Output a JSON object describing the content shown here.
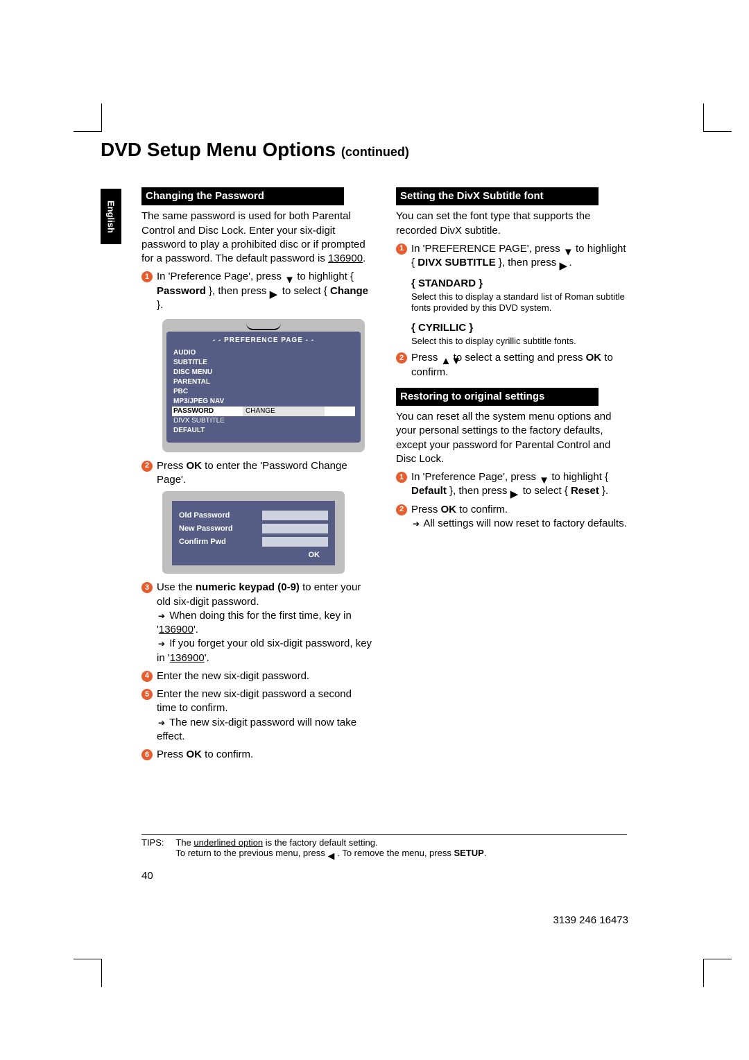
{
  "page_title": "DVD Setup Menu Options",
  "page_title_suffix": "(continued)",
  "language_tab": "English",
  "left": {
    "header": "Changing the Password",
    "intro_1": "The same password is used for both Parental Control and Disc Lock. Enter your six-digit password to play a prohibited disc or if prompted for a password. The default password is ",
    "intro_default_pw": "136900",
    "step1_a": "In 'Preference Page', press ",
    "step1_b": " to highlight { ",
    "step1_bold_password": "Password",
    "step1_c": " }, then press ",
    "step1_d": " to select { ",
    "step1_bold_change": "Change",
    "step1_e": " }.",
    "osd_header": "- -   PREFERENCE  PAGE   - -",
    "osd_items": [
      "AUDIO",
      "SUBTITLE",
      "DISC MENU",
      "PARENTAL",
      "PBC",
      "MP3/JPEG NAV",
      "PASSWORD",
      "DIVX SUBTITLE",
      "DEFAULT"
    ],
    "osd_password_value": "CHANGE",
    "step2_a": "Press ",
    "step2_ok": "OK",
    "step2_b": " to enter the 'Password Change Page'.",
    "pwd_old": "Old Password",
    "pwd_new": "New Password",
    "pwd_conf": "Confirm Pwd",
    "pwd_ok": "OK",
    "step3_a": "Use the ",
    "step3_bold": "numeric keypad (0-9)",
    "step3_b": " to enter your old six-digit password.",
    "step3_note1": "When doing this for the first time, key in '",
    "step3_note1_pw": "136900",
    "step3_note1_end": "'.",
    "step3_note2_a": "If you forget your old six-digit password, key in '",
    "step3_note2_pw": "136900",
    "step3_note2_end": "'.",
    "step4": "Enter the new six-digit password.",
    "step5_a": "Enter the new six-digit password a second time to confirm.",
    "step5_note": "The new six-digit password will now take effect.",
    "step6_a": "Press ",
    "step6_ok": "OK",
    "step6_b": " to confirm."
  },
  "right": {
    "header1": "Setting the DivX Subtitle font",
    "intro1": "You can set the font type that supports the recorded DivX subtitle.",
    "r1_a": "In 'PREFERENCE PAGE', press ",
    "r1_b": " to highlight { ",
    "r1_bold": "DIVX SUBTITLE",
    "r1_c": " }, then press ",
    "r1_d": ".",
    "opt_std_name": "{ STANDARD }",
    "opt_std_desc": "Select this to display a standard list of Roman subtitle fonts provided by this DVD system.",
    "opt_cyr_name": "{ CYRILLIC }",
    "opt_cyr_desc": "Select this to display cyrillic subtitle fonts.",
    "r2_a": "Press ",
    "r2_b": " to select a setting and press ",
    "r2_ok": "OK",
    "r2_c": " to confirm.",
    "header2": "Restoring to original settings",
    "intro2": "You can reset all the system menu options and your personal settings to the factory defaults, except your password for Parental Control and Disc Lock.",
    "rr1_a": "In 'Preference Page', press ",
    "rr1_b": " to highlight { ",
    "rr1_bold_default": "Default",
    "rr1_c": " }, then press ",
    "rr1_d": " to select { ",
    "rr1_bold_reset": "Reset",
    "rr1_e": " }.",
    "rr2_a": "Press ",
    "rr2_ok": "OK",
    "rr2_b": " to confirm.",
    "rr2_note": "All settings will now reset to factory defaults."
  },
  "tips": {
    "label": "TIPS:",
    "line1_a": "The ",
    "line1_u": "underlined option",
    "line1_b": " is the factory default setting.",
    "line2_a": "To return to the previous menu, press ",
    "line2_b": ". To remove the menu, press ",
    "line2_bold": "SETUP",
    "line2_c": "."
  },
  "page_number": "40",
  "doc_number": "3139 246 16473"
}
